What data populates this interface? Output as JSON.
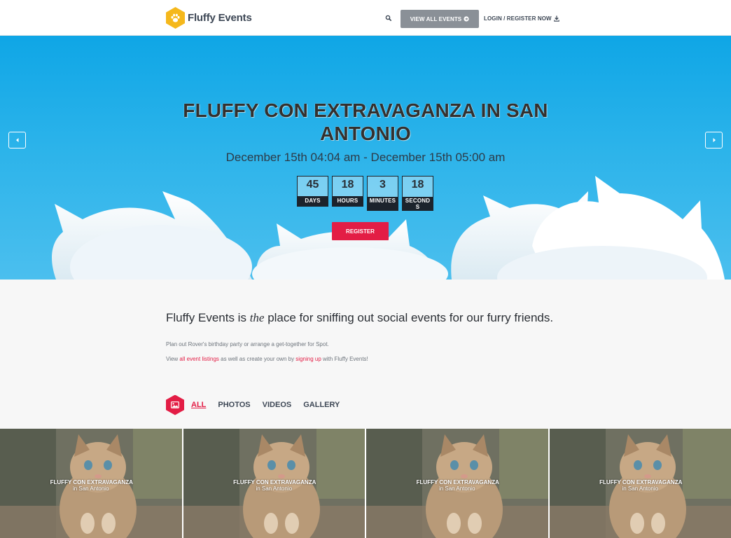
{
  "brand": {
    "name": "Fluffy Events",
    "icon": "paw-icon",
    "color": "#f5b81c"
  },
  "nav": {
    "search_icon": "search-icon",
    "view_all_label": "VIEW ALL EVENTS",
    "view_all_icon": "arrow-circle-right-icon",
    "login_label": "LOGIN / REGISTER NOW",
    "login_icon": "download-icon"
  },
  "hero": {
    "title": "FLUFFY CON EXTRAVAGANZA IN SAN ANTONIO",
    "dates": "December 15th 04:04 am - December 15th 05:00 am",
    "countdown": [
      {
        "value": "45",
        "label": "DAYS"
      },
      {
        "value": "18",
        "label": "HOURS"
      },
      {
        "value": "3",
        "label": "MINUTES"
      },
      {
        "value": "18",
        "label": "SECONDS"
      }
    ],
    "register_label": "REGISTER",
    "prev_icon": "caret-left-icon",
    "next_icon": "caret-right-icon"
  },
  "intro": {
    "headline_pre": "Fluffy Events is ",
    "headline_em": "the",
    "headline_post": " place for sniffing out social events for our furry friends.",
    "subline": "Plan out Rover's birthday party or arrange a get-together for Spot.",
    "links_pre": "View ",
    "link_listings": "all event listings",
    "links_mid": " as well as create your own by ",
    "link_signup": "signing up",
    "links_post": " with Fluffy Events!"
  },
  "tabs": {
    "icon": "image-icon",
    "items": [
      "ALL",
      "PHOTOS",
      "VIDEOS",
      "GALLERY"
    ],
    "active": "ALL"
  },
  "gallery": [
    {
      "title": "FLUFFY CON EXTRAVAGANZA",
      "subtitle": "in San Antonio"
    },
    {
      "title": "FLUFFY CON EXTRAVAGANZA",
      "subtitle": "in San Antonio"
    },
    {
      "title": "FLUFFY CON EXTRAVAGANZA",
      "subtitle": "in San Antonio"
    },
    {
      "title": "FLUFFY CON EXTRAVAGANZA",
      "subtitle": "in San Antonio"
    }
  ],
  "colors": {
    "accent": "#e31d45",
    "hero_sky": "#1aaae8",
    "nav_button": "#8a9097",
    "text_dark": "#3d4755"
  }
}
